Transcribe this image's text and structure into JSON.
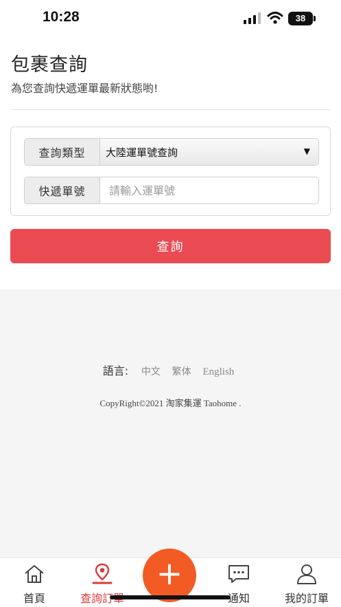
{
  "status_bar": {
    "time": "10:28",
    "battery": "38"
  },
  "header": {
    "title": "包裹查詢",
    "subtitle": "為您查詢快遞運單最新狀態喲!"
  },
  "form": {
    "type_label": "查詢類型",
    "type_value": "大陸運單號查詢",
    "number_label": "快遞單號",
    "number_placeholder": "請輸入運單號",
    "submit_label": "查詢"
  },
  "footer": {
    "language_label": "語言:",
    "languages": [
      "中文",
      "繁体",
      "English"
    ],
    "copyright": "CopyRight©2021 淘家集運 Taohome ."
  },
  "tabbar": {
    "items": [
      {
        "label": "首頁",
        "icon": "home-icon"
      },
      {
        "label": "查詢訂單",
        "icon": "location-pin-icon",
        "active": true
      },
      {
        "label": "",
        "icon": "plus-icon"
      },
      {
        "label": "通知",
        "icon": "chat-bubble-icon"
      },
      {
        "label": "我的訂單",
        "icon": "user-icon"
      }
    ],
    "fab_symbol": "+"
  },
  "colors": {
    "accent": "#ea4a52",
    "fab": "#f35b24",
    "active_tab": "#d83a3a"
  }
}
